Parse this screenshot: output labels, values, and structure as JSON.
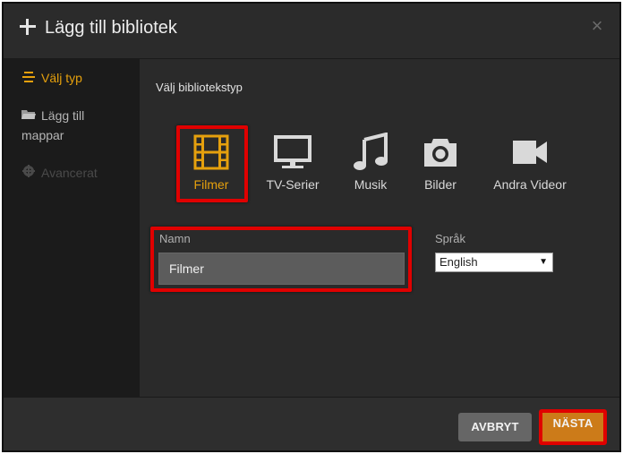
{
  "dialog": {
    "title": "Lägg till bibliotek",
    "close_icon": "close-icon"
  },
  "sidebar": {
    "items": [
      {
        "label": "Välj typ",
        "icon": "list-icon",
        "active": true
      },
      {
        "label": "Lägg till mappar",
        "icon": "folder-icon",
        "active": false
      },
      {
        "label": "Avancerat",
        "icon": "gear-icon",
        "active": false,
        "disabled": true
      }
    ]
  },
  "main": {
    "section_title": "Välj bibliotekstyp",
    "types": [
      {
        "label": "Filmer",
        "icon": "film-icon",
        "selected": true
      },
      {
        "label": "TV-Serier",
        "icon": "tv-icon",
        "selected": false
      },
      {
        "label": "Musik",
        "icon": "music-icon",
        "selected": false
      },
      {
        "label": "Bilder",
        "icon": "camera-icon",
        "selected": false
      },
      {
        "label": "Andra Videor",
        "icon": "video-camera-icon",
        "selected": false
      }
    ],
    "name_label": "Namn",
    "name_value": "Filmer",
    "language_label": "Språk",
    "language_value": "English"
  },
  "footer": {
    "cancel_label": "AVBRYT",
    "next_label": "NÄSTA"
  },
  "colors": {
    "accent": "#e5a00d",
    "next_button": "#cc7b19",
    "highlight": "#e00000"
  }
}
